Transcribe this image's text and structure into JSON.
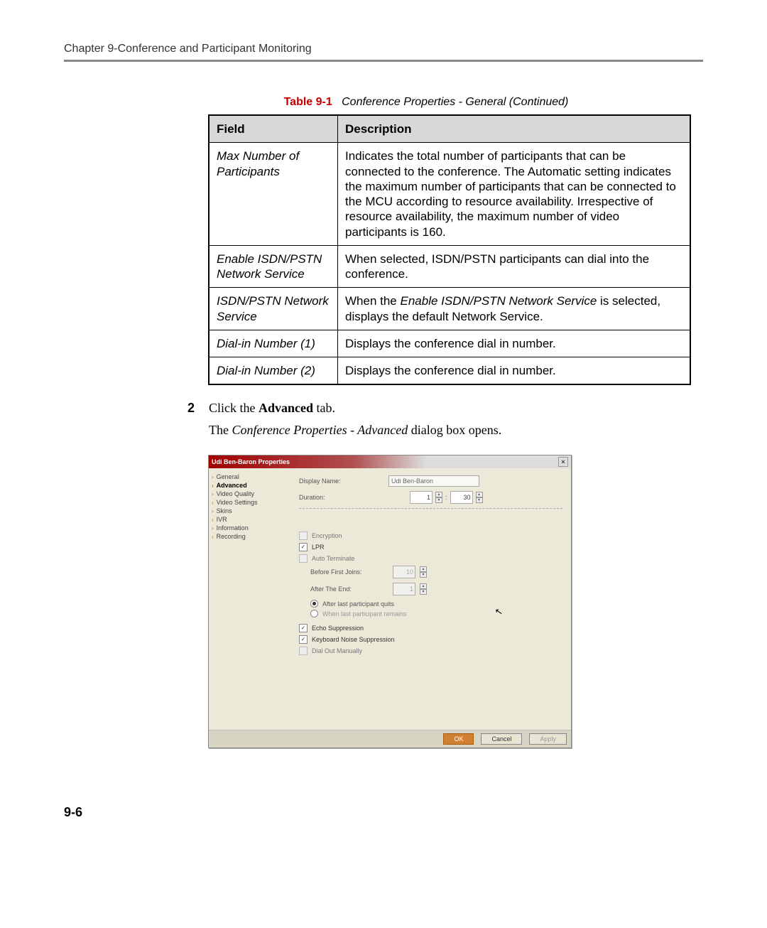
{
  "header": "Chapter 9-Conference and Participant Monitoring",
  "table_caption_label": "Table 9-1",
  "table_caption_title": "Conference Properties - General (Continued)",
  "columns": {
    "field": "Field",
    "description": "Description"
  },
  "rows": [
    {
      "field": "Max Number of Participants",
      "desc": "Indicates the total number of participants that can be connected to the conference. The Automatic setting indicates the maximum number of participants that can be connected to the MCU according to resource availability. Irrespective of resource availability, the maximum number of video participants is 160."
    },
    {
      "field": "Enable ISDN/PSTN Network Service",
      "desc": "When selected, ISDN/PSTN participants can dial into the conference."
    },
    {
      "field": "ISDN/PSTN Network Service",
      "desc_prefix": "When the ",
      "desc_em": "Enable ISDN/PSTN Network Service",
      "desc_suffix": " is selected, displays the default Network Service."
    },
    {
      "field": "Dial-in Number (1)",
      "desc": "Displays the conference dial in number."
    },
    {
      "field": "Dial-in Number (2)",
      "desc": "Displays the conference dial in number."
    }
  ],
  "step": {
    "num": "2",
    "line1_prefix": "Click the ",
    "line1_bold": "Advanced",
    "line1_suffix": " tab.",
    "line2_prefix": "The ",
    "line2_italic": "Conference Properties - Advanced",
    "line2_suffix": " dialog box opens."
  },
  "dialog": {
    "title": "Udi Ben-Baron Properties",
    "nav": [
      "General",
      "Advanced",
      "Video Quality",
      "Video Settings",
      "Skins",
      "IVR",
      "Information",
      "Recording"
    ],
    "nav_selected": "Advanced",
    "display_name_label": "Display Name:",
    "display_name_value": "Udi Ben-Baron",
    "duration_label": "Duration:",
    "duration_h": "1",
    "duration_sep": ":",
    "duration_m": "30",
    "encryption": "Encryption",
    "lpr": "LPR",
    "auto_terminate": "Auto Terminate",
    "before_first": "Before First Joins:",
    "before_first_val": "10",
    "after_end": "After The End:",
    "after_end_val": "1",
    "radio_quits": "After last participant quits",
    "radio_remains": "When last participant remains",
    "echo": "Echo Suppression",
    "keyb": "Keyboard Noise Suppression",
    "dialout": "Dial Out Manually",
    "ok": "OK",
    "cancel": "Cancel",
    "apply": "Apply"
  },
  "page_number": "9-6"
}
